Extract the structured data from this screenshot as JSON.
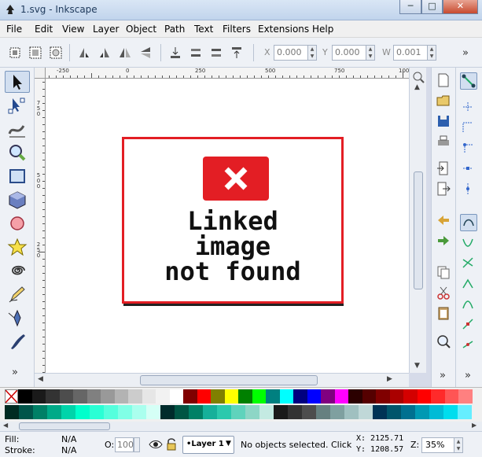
{
  "window": {
    "title": "1.svg - Inkscape",
    "btn_minimize": "─",
    "btn_maximize": "□",
    "btn_close": "✕"
  },
  "menu": [
    "File",
    "Edit",
    "View",
    "Layer",
    "Object",
    "Path",
    "Text",
    "Filters",
    "Extensions",
    "Help"
  ],
  "toolbar": {
    "x_label": "X",
    "x_value": "0.000",
    "y_label": "Y",
    "y_value": "0.000",
    "w_label": "W",
    "w_value": "0.001",
    "more": "»"
  },
  "ruler": {
    "h_labels": [
      "-250",
      "0",
      "250",
      "500",
      "750",
      "100"
    ],
    "v_labels": [
      "7\n5\n0",
      "5\n0\n0",
      "2\n5\n0"
    ]
  },
  "canvas": {
    "placeholder_line1": "Linked",
    "placeholder_line2": "image",
    "placeholder_line3": "not found",
    "accent_red": "#e31e24"
  },
  "tools": [
    "selector-tool",
    "node-tool",
    "tweak-tool",
    "zoom-tool",
    "rect-tool",
    "3dbox-tool",
    "ellipse-tool",
    "star-tool",
    "spiral-tool",
    "pencil-tool",
    "pen-tool",
    "calligraphy-tool"
  ],
  "toolbox_more": "»",
  "status": {
    "fill_label": "Fill:",
    "fill_value": "N/A",
    "stroke_label": "Stroke:",
    "stroke_value": "N/A",
    "opacity_label": "O:",
    "opacity_value": "100",
    "layer_name": "•Layer 1",
    "message": "No objects selected. Click, ...",
    "x_readout": "X: 2125.71",
    "y_readout": "Y: 1208.57",
    "zoom_label": "Z:",
    "zoom_value": "35%"
  },
  "palette_row1": [
    "#000000",
    "#1a1a1a",
    "#333333",
    "#4d4d4d",
    "#666666",
    "#808080",
    "#999999",
    "#b3b3b3",
    "#cccccc",
    "#e6e6e6",
    "#f2f2f2",
    "#ffffff",
    "#800000",
    "#ff0000",
    "#808000",
    "#ffff00",
    "#008000",
    "#00ff00",
    "#008080",
    "#00ffff",
    "#000080",
    "#0000ff",
    "#800080",
    "#ff00ff",
    "#2b0000",
    "#550000",
    "#800000",
    "#aa0000",
    "#d40000",
    "#ff0000",
    "#ff2a2a",
    "#ff5555",
    "#ff8080"
  ],
  "palette_row2": [
    "#002b22",
    "#00554a",
    "#008066",
    "#00aa88",
    "#00d4aa",
    "#00ffcc",
    "#2affd5",
    "#55ffdd",
    "#80ffe6",
    "#aaffee",
    "#d5fff6",
    "#002b2b",
    "#005544",
    "#008066",
    "#16b09a",
    "#2cc9ad",
    "#5fd3bc",
    "#8dd6c6",
    "#c4eae2",
    "#1a1a1a",
    "#333333",
    "#4d4d4d",
    "#668080",
    "#7fa0a0",
    "#a0c0c0",
    "#c0d8d8",
    "#003355",
    "#00556b",
    "#007090",
    "#0099b3",
    "#00bbd6",
    "#00ddee",
    "#66eeff"
  ]
}
